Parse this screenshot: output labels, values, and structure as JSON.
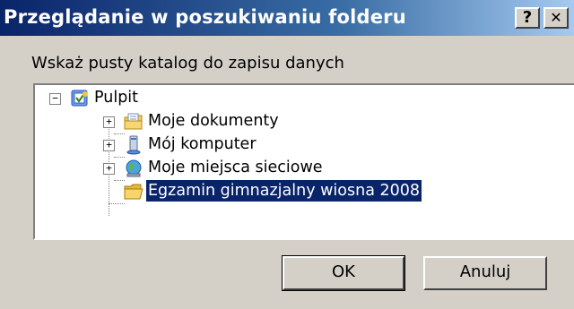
{
  "window": {
    "title": "Przeglądanie w poszukiwaniu folderu",
    "help_glyph": "?",
    "close_glyph": "✕"
  },
  "prompt": "Wskaż pusty katalog do zapisu danych",
  "tree": {
    "root": {
      "label": "Pulpit",
      "expander": "−",
      "icon": "desktop-icon"
    },
    "children": [
      {
        "label": "Moje dokumenty",
        "expander": "+",
        "icon": "documents-folder-icon"
      },
      {
        "label": "Mój komputer",
        "expander": "+",
        "icon": "computer-icon"
      },
      {
        "label": "Moje miejsca sieciowe",
        "expander": "+",
        "icon": "network-places-icon"
      },
      {
        "label": "Egzamin gimnazjalny wiosna 2008",
        "expander": "",
        "icon": "folder-open-icon",
        "selected": true
      }
    ]
  },
  "buttons": {
    "ok_label": "OK",
    "cancel_label": "Anuluj"
  },
  "colors": {
    "title_gradient_start": "#0a246a",
    "title_gradient_end": "#a6caf0",
    "face": "#d4d0c8",
    "selection": "#0a246a"
  }
}
